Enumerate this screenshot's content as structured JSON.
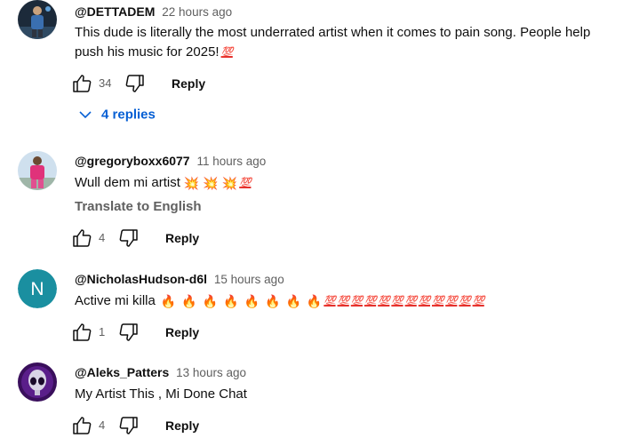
{
  "comments": [
    {
      "author": "@DETTADEM",
      "time": "22 hours ago",
      "text": "This dude is literally the most underrated artist when it comes to pain song. People help push his music for 2025!",
      "emojis": [
        "💯"
      ],
      "likes": "34",
      "reply_label": "Reply",
      "replies_label": "4 replies"
    },
    {
      "author": "@gregoryboxx6077",
      "time": "11 hours ago",
      "text": "Wull dem mi artist",
      "emojis": [
        "💥",
        "💥",
        "💥",
        "💯"
      ],
      "translate_label": "Translate to English",
      "likes": "4",
      "reply_label": "Reply"
    },
    {
      "author": "@NicholasHudson-d6l",
      "time": "15 hours ago",
      "avatar_letter": "N",
      "avatar_color": "#1a8fa0",
      "text": "Active mi killa",
      "emojis": [
        "🔥",
        "🔥",
        "🔥",
        "🔥",
        "🔥",
        "🔥",
        "🔥",
        "🔥",
        "💯",
        "💯",
        "💯",
        "💯",
        "💯",
        "💯",
        "💯",
        "💯",
        "💯",
        "💯",
        "💯",
        "💯"
      ],
      "likes": "1",
      "reply_label": "Reply"
    },
    {
      "author": "@Aleks_Patters",
      "time": "13 hours ago",
      "text": "My Artist This , Mi Done Chat",
      "likes": "4",
      "reply_label": "Reply"
    }
  ],
  "icons": {
    "like": "thumbs-up-icon",
    "dislike": "thumbs-down-icon",
    "expand": "chevron-down-icon",
    "collision": "collision-emoji",
    "fire": "fire-emoji",
    "hundred": "hundred-points-emoji"
  },
  "colors": {
    "link_blue": "#065fd4",
    "secondary_text": "#606060",
    "primary_text": "#0f0f0f"
  }
}
